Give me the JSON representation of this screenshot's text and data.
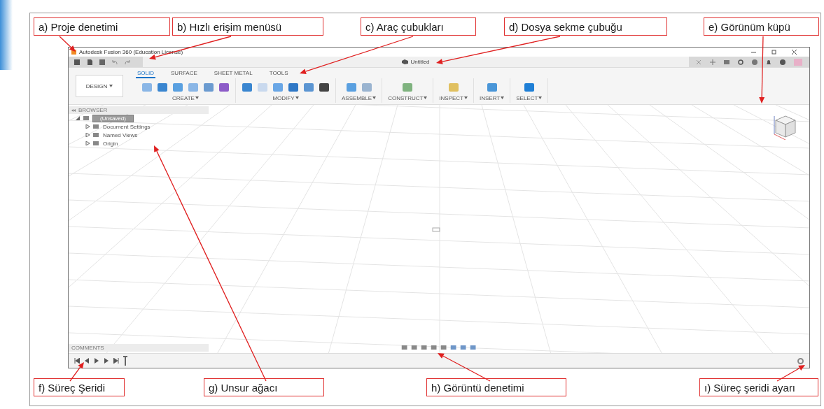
{
  "annotations_top": [
    {
      "label": "a) Proje denetimi"
    },
    {
      "label": "b) Hızlı erişim menüsü"
    },
    {
      "label": "c) Araç çubukları"
    },
    {
      "label": "d) Dosya sekme çubuğu"
    },
    {
      "label": "e) Görünüm küpü"
    }
  ],
  "annotations_bottom": [
    {
      "label": "f) Süreç Şeridi"
    },
    {
      "label": "g) Unsur ağacı"
    },
    {
      "label": "h) Görüntü denetimi"
    },
    {
      "label": "ı) Süreç şeridi ayarı"
    }
  ],
  "window": {
    "title": "Autodesk Fusion 360 (Education License)",
    "document_tab": "Untitled",
    "workspace": "DESIGN",
    "ribbon_tabs": [
      {
        "label": "SOLID",
        "selected": true
      },
      {
        "label": "SURFACE",
        "selected": false
      },
      {
        "label": "SHEET METAL",
        "selected": false
      },
      {
        "label": "TOOLS",
        "selected": false
      }
    ],
    "tool_groups": [
      {
        "label": "CREATE"
      },
      {
        "label": "MODIFY"
      },
      {
        "label": "ASSEMBLE"
      },
      {
        "label": "CONSTRUCT"
      },
      {
        "label": "INSPECT"
      },
      {
        "label": "INSERT"
      },
      {
        "label": "SELECT"
      }
    ],
    "browser": {
      "title": "BROWSER",
      "root": {
        "label": "(Unsaved)",
        "expanded": true,
        "selected": true,
        "children": [
          {
            "label": "Document Settings",
            "expanded": false,
            "selected": false
          },
          {
            "label": "Named Views",
            "expanded": false,
            "selected": false
          },
          {
            "label": "Origin",
            "expanded": false,
            "selected": false
          }
        ]
      }
    },
    "comments": {
      "title": "COMMENTS"
    }
  }
}
